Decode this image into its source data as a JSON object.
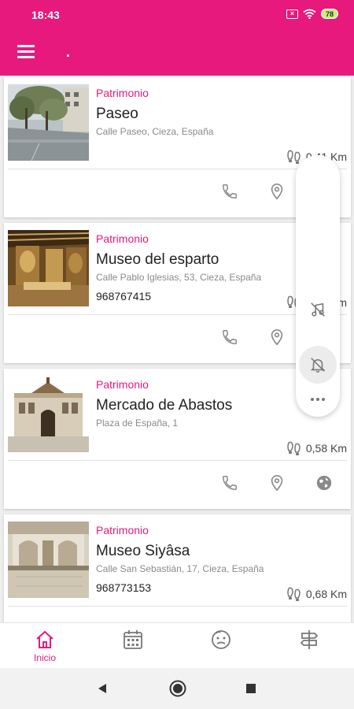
{
  "status_bar": {
    "time": "18:43",
    "battery": "78"
  },
  "app_bar": {
    "title": "."
  },
  "colors": {
    "accent": "#e8197d",
    "icon_gray": "#8a8a8a"
  },
  "places": [
    {
      "category": "Patrimonio",
      "name": "Paseo",
      "address": "Calle Paseo, Cieza, España",
      "phone": "",
      "distance": "0,41 Km"
    },
    {
      "category": "Patrimonio",
      "name": "Museo del esparto",
      "address": "Calle Pablo Iglesias, 53, Cieza, España",
      "phone": "968767415",
      "distance": "0,49 Km"
    },
    {
      "category": "Patrimonio",
      "name": "Mercado de Abastos",
      "address": "Plaza de España, 1",
      "phone": "",
      "distance": "0,58 Km"
    },
    {
      "category": "Patrimonio",
      "name": "Museo Siyâsa",
      "address": "Calle San Sebastián, 17, Cieza, España",
      "phone": "968773153",
      "distance": "0,68 Km"
    }
  ],
  "fab_menu": {
    "items": [
      "music-note-off-icon",
      "bell-off-icon",
      "more-dots-icon"
    ]
  },
  "bottom_nav": {
    "items": [
      {
        "label": "Inicio",
        "icon": "home-icon",
        "active": true
      },
      {
        "label": "",
        "icon": "calendar-icon",
        "active": false
      },
      {
        "label": "",
        "icon": "face-icon",
        "active": false
      },
      {
        "label": "",
        "icon": "signpost-icon",
        "active": false
      }
    ]
  }
}
